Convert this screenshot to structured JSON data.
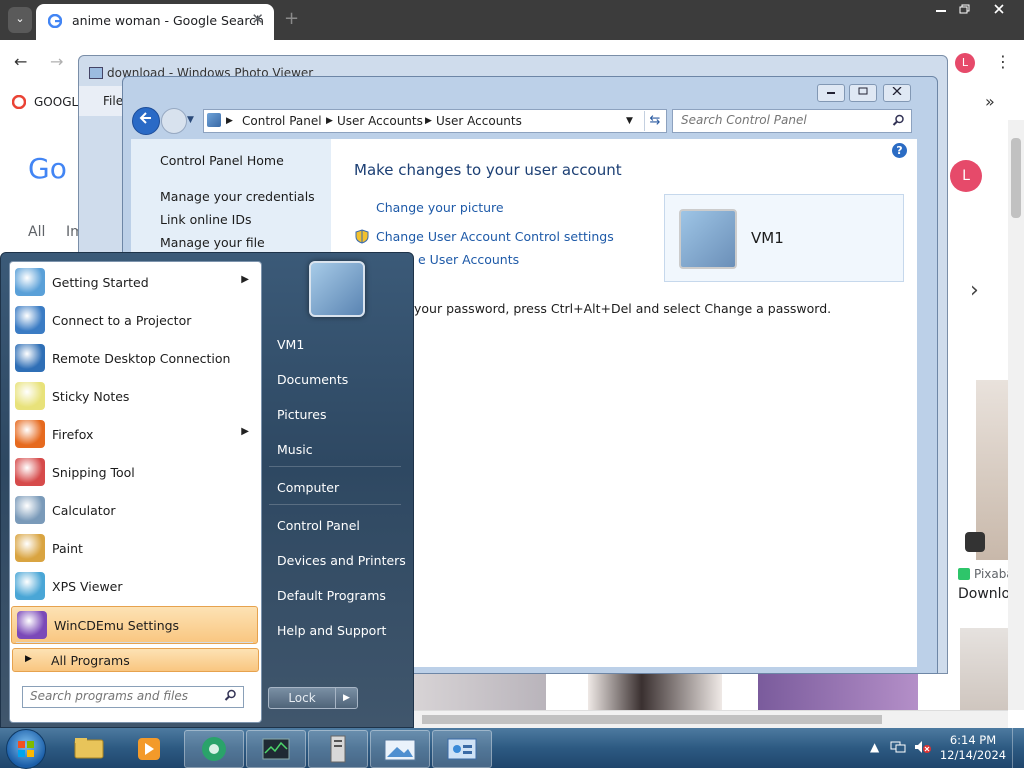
{
  "browser": {
    "tab_title": "anime woman - Google Search",
    "tab_close": "✕",
    "new_tab": "+",
    "tab_list": "⌄",
    "profile_initial": "L",
    "bookmark_label": "GOOGLI",
    "nav_back": "←",
    "nav_forward": "→",
    "reload": "↻",
    "menu": "⋮",
    "more_bookmarks": "»",
    "page": {
      "tab_all": "All",
      "tab_images_partial": "Im",
      "logo_partial": "Go",
      "source_name": "Pixaba",
      "result_title": "Downlo",
      "carousel_next": "›"
    }
  },
  "photo_viewer": {
    "title": "download - Windows Photo Viewer",
    "file_menu": "File"
  },
  "control_panel": {
    "breadcrumb": [
      "Control Panel",
      "User Accounts",
      "User Accounts"
    ],
    "search_placeholder": "Search Control Panel",
    "left_links": [
      "Control Panel Home",
      "Manage your credentials",
      "Link online IDs",
      "Manage your file encryption"
    ],
    "heading": "Make changes to your user account",
    "links": {
      "change_picture": "Change your picture",
      "uac": "Change User Account Control settings",
      "manage_partial": "e User Accounts"
    },
    "note_partial": "your password, press Ctrl+Alt+Del and select Change a password.",
    "account_name": "VM1",
    "help": "?"
  },
  "start_menu": {
    "programs": [
      {
        "label": "Getting Started",
        "icon": "getting-started-icon",
        "arrow": true,
        "color": "#5aa0d8"
      },
      {
        "label": "Connect to a Projector",
        "icon": "projector-icon",
        "arrow": false,
        "color": "#3b7cc4"
      },
      {
        "label": "Remote Desktop Connection",
        "icon": "remote-desktop-icon",
        "arrow": false,
        "color": "#2f6fb6"
      },
      {
        "label": "Sticky Notes",
        "icon": "sticky-notes-icon",
        "arrow": false,
        "color": "#e8e27a"
      },
      {
        "label": "Firefox",
        "icon": "firefox-icon",
        "arrow": true,
        "color": "#e66a1f"
      },
      {
        "label": "Snipping Tool",
        "icon": "snipping-tool-icon",
        "arrow": false,
        "color": "#d64b4b"
      },
      {
        "label": "Calculator",
        "icon": "calculator-icon",
        "arrow": false,
        "color": "#7a9ab9"
      },
      {
        "label": "Paint",
        "icon": "paint-icon",
        "arrow": false,
        "color": "#d9a441"
      },
      {
        "label": "XPS Viewer",
        "icon": "xps-viewer-icon",
        "arrow": false,
        "color": "#4aa6d6"
      },
      {
        "label": "WinCDEmu Settings",
        "icon": "wincdemu-icon",
        "arrow": false,
        "color": "#7b49b8",
        "highlight": true
      }
    ],
    "all_programs": "All Programs",
    "search_placeholder": "Search programs and files",
    "right_items": [
      "VM1",
      "Documents",
      "Pictures",
      "Music",
      "Computer",
      "Control Panel",
      "Devices and Printers",
      "Default Programs",
      "Help and Support"
    ],
    "lock": "Lock"
  },
  "taskbar": {
    "time": "6:14 PM",
    "date": "12/14/2024"
  }
}
